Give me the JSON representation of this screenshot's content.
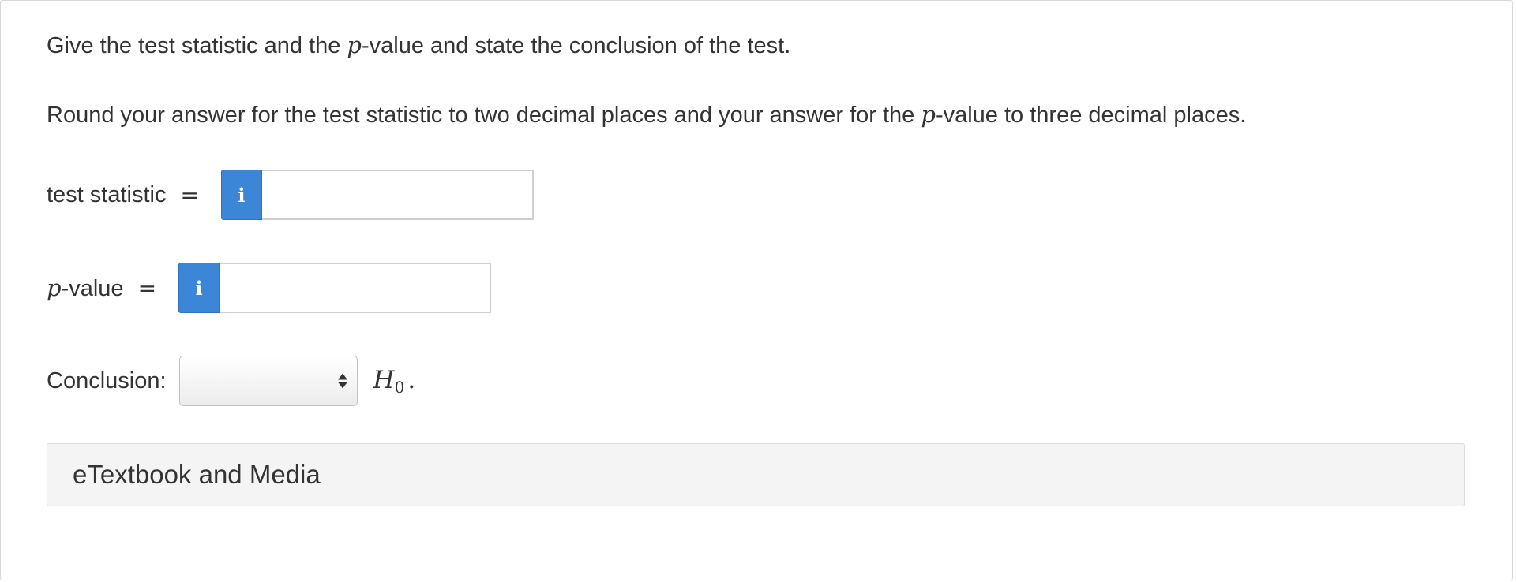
{
  "question": {
    "line1": {
      "before": "Give the test statistic and the ",
      "p": "p",
      "after": "-value and state the conclusion of the test."
    },
    "line2": {
      "before": "Round your answer for the test statistic to two decimal places and your answer for the ",
      "p": "p",
      "after": "-value to three decimal places."
    }
  },
  "test_statistic": {
    "label": "test statistic",
    "eq": "=",
    "info_glyph": "i",
    "value": "",
    "placeholder": ""
  },
  "p_value": {
    "label_p": "p",
    "label_rest": "-value",
    "eq": "=",
    "info_glyph": "i",
    "value": "",
    "placeholder": ""
  },
  "conclusion": {
    "label": "Conclusion:",
    "selected": "",
    "h_letter": "H",
    "h_sub": "0",
    "period": "."
  },
  "etextbook": {
    "label": "eTextbook and Media"
  },
  "colors": {
    "info_button": "#3b86d6",
    "text": "#333333",
    "media_bar_bg": "#f4f4f4"
  },
  "icons": {
    "info": "info-icon",
    "select": "select-updown-arrows-icon"
  }
}
